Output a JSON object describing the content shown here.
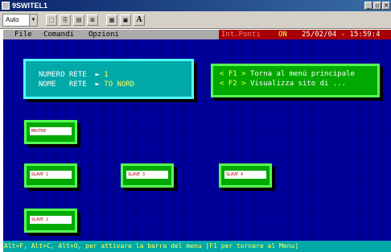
{
  "window": {
    "title": "9SWITEL1",
    "btn_min": "_",
    "btn_max": "▫",
    "btn_close": "✕"
  },
  "toolbar": {
    "font_combo": "Auto",
    "combo_arrow": "▼",
    "font_button": "A"
  },
  "menubar": {
    "items": [
      "File",
      "Comandi",
      "Opzioni"
    ],
    "status_label": "Int.Ponti",
    "status_flag": "ON",
    "datetime": "25/02/04 - 15:59:4"
  },
  "info": {
    "numero_label": "NUMERO RETE  ►",
    "numero_value": "1",
    "nome_label": "NOME   RETE  ►",
    "nome_value": "TO NORD"
  },
  "keys": {
    "f1_key": "< F1 >",
    "f1_text": "Torna al menù principale",
    "f2_key": "< F2 >",
    "f2_text": "Visualizza sito di ..."
  },
  "nodes": {
    "master": "MASTER",
    "slave1": "SLAVE 1",
    "slave2": "SLAVE 2",
    "slave3": "SLAVE 3",
    "slave4": "SLAVE 4"
  },
  "statusbar": {
    "text": "Alt+F, Alt+C, Alt+O, per attivare la barra del menu [F1 per tornare al Menu]"
  }
}
